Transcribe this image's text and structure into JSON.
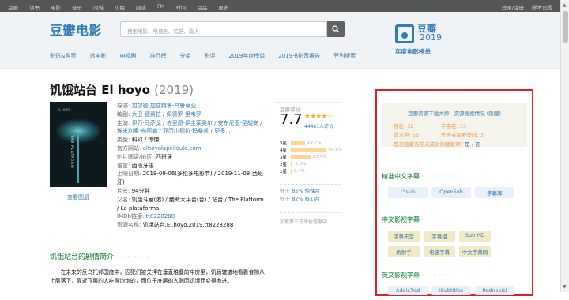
{
  "topbar": {
    "nav": [
      "豆瓣",
      "读书",
      "电影",
      "音乐",
      "同城",
      "小组",
      "阅读",
      "FM",
      "时间",
      "豆品",
      "更多"
    ],
    "login": "登录/注册",
    "settings": "脚本设置"
  },
  "header": {
    "logo": "豆瓣电影",
    "search_placeholder": "搜索电影、电视剧、综艺、影人",
    "subnav": [
      "影讯&购票",
      "选电影",
      "电视剧",
      "排行榜",
      "分类",
      "影评",
      "2019年度榜单",
      "2019书影音报告",
      "豆列搜索"
    ],
    "badge": {
      "name": "豆瓣",
      "year": "2019",
      "subtitle": "年度电影榜单"
    }
  },
  "movie": {
    "title": "饥饿站台 El hoyo",
    "year": "(2019)",
    "view_stills": "查看图册",
    "poster_text": "THE PLATFORM",
    "info": [
      {
        "k": "导演: ",
        "v": "加尔德·加兹特鲁-乌鲁蒂亚",
        "link": true
      },
      {
        "k": "编剧: ",
        "v": "大卫·德素拉 / 佩德罗·里韦罗",
        "link": true
      },
      {
        "k": "主演: ",
        "v": "伊万·马萨戈 / 佐里昂·伊圭莱奥尔 / 安东尼亚·圣胡安 / 埃米利奥·布阿勒 / 亚历山德拉·玛桑凯 / 更多...",
        "link": true
      },
      {
        "k": "类型: ",
        "v": "科幻 / 惊悚",
        "link": false
      },
      {
        "k": "官方网站: ",
        "v": "elhoyolapelicula.com",
        "link": true
      },
      {
        "k": "制片国家/地区: ",
        "v": "西班牙",
        "link": false
      },
      {
        "k": "语言: ",
        "v": "西班牙语",
        "link": false
      },
      {
        "k": "上映日期: ",
        "v": "2019-09-06(多伦多电影节) / 2019-11-08(西班牙)",
        "link": false
      },
      {
        "k": "片长: ",
        "v": "94分钟",
        "link": false
      },
      {
        "k": "又名: ",
        "v": "饥饿斗室(港) / 绝命大平台(台) / 站台 / The Platform / La plataforma",
        "link": false
      },
      {
        "k": "IMDb链接: ",
        "v": "tt8228288",
        "link": true
      },
      {
        "k": "资源名称: ",
        "v": "饥饿站台.El.hoyo.2019.tt8228288",
        "link": false
      }
    ],
    "summary_heading": "饥饿站台的剧情简介",
    "summary_dots": "· · · · · ·",
    "summary": "在未来的反乌托邦国度中，囚犯们被关押在垂直堆叠的牢房里，饥肠辘辘地看着食物从上层落下，靠近顶层的人吃得饱饱的，而位于底层的人则因饥饿而变得激进。"
  },
  "rating": {
    "label": "豆瓣评分",
    "score": "7.7",
    "stars": "★★★★☆",
    "votes": "44461人评价",
    "distribution": [
      {
        "star": "5星",
        "pct": 19.7,
        "label": "19.7%"
      },
      {
        "star": "4星",
        "pct": 49.6,
        "label": "49.6%"
      },
      {
        "star": "3星",
        "pct": 27.7,
        "label": "27.7%"
      },
      {
        "star": "2星",
        "pct": 2.6,
        "label": "2.6%"
      },
      {
        "star": "1星",
        "pct": 0.4,
        "label": "0.4%"
      }
    ],
    "better1_prefix": "好于 ",
    "better1_link": "85% 惊悚片",
    "better2_prefix": "好于 ",
    "better2_link": "82% 科幻片",
    "add_third": "加载第三方评价信息中..."
  },
  "panel": {
    "resource_title": "豆瓣资源下载大师：资源搜索情况 (隐藏)",
    "exist_label": "存在: ",
    "exist_val": "32",
    "notexist_label": "不存在: ",
    "notexist_val": "33",
    "request_label": "请求中: ",
    "request_val": "56",
    "failed_label": "失败或需要登陆: ",
    "failed_val": "3",
    "question": "是否隐藏当前未成功的搜索项?",
    "yes": "是",
    "sep": " / ",
    "no": "否",
    "sections": [
      {
        "title": "精准中文字幕",
        "dots": "· · · · · ·",
        "style": "blue",
        "tags": [
          "r3sub",
          "OpenSub",
          "字幕库"
        ]
      },
      {
        "title": "中文影视字幕",
        "dots": "· · · · · ·",
        "style": "gold",
        "tags": [
          "字幕天堂",
          "字幕组",
          "Sub HD",
          "伪射手",
          "电波字幕",
          "中文字幕网"
        ]
      },
      {
        "title": "英文影视字幕",
        "dots": "· · · · · ·",
        "style": "blue",
        "tags": [
          "Addic7ed",
          "iSubtitles",
          "Podnapisi"
        ]
      }
    ]
  }
}
